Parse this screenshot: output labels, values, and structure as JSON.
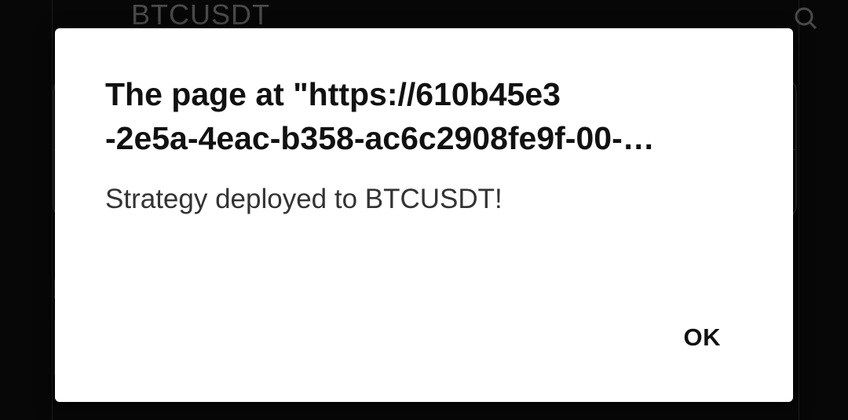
{
  "background": {
    "search_value": "BTCUSDT",
    "search_icon": "search-icon"
  },
  "dialog": {
    "title_line1": "The page at \"https://610b45e3",
    "title_line2": "-2e5a-4eac-b358-ac6c2908fe9f-00-…",
    "message": "Strategy deployed to BTCUSDT!",
    "ok_label": "OK"
  }
}
